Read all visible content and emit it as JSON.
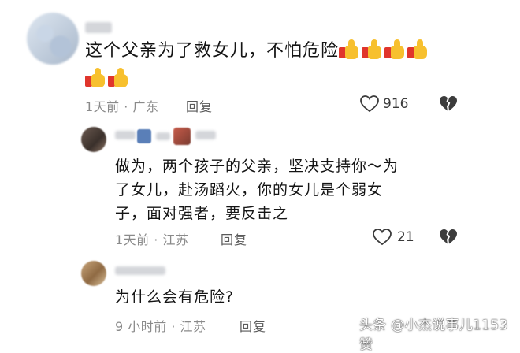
{
  "main_comment": {
    "text": "这个父亲为了救女儿，不怕危险",
    "thumbs_line1": 4,
    "thumbs_line2": 2,
    "time_location": "1天前 · 广东",
    "reply_label": "回复",
    "likes": "916"
  },
  "replies": [
    {
      "text_lines": [
        "做为，两个孩子的父亲，坚决支持你～为",
        "了女儿，赴汤蹈火，你的女儿是个弱女",
        "子，面对强者，要反击之"
      ],
      "time_location": "1天前 · 江苏",
      "reply_label": "回复",
      "likes": "21"
    },
    {
      "text_lines": [
        "为什么会有危险?"
      ],
      "time_location": "9 小时前 · 江苏",
      "reply_label": "回复"
    }
  ],
  "watermark": "头条 @小杰说事儿1153赞",
  "icons": {
    "like": "heart-outline-icon",
    "dislike": "broken-heart-icon",
    "thumbs": "thumbs-up-emoji-icon"
  },
  "colors": {
    "thumb_yellow": "#f7c02e",
    "thumb_cuff": "#e0352c",
    "meta_gray": "#8a8a8a"
  }
}
